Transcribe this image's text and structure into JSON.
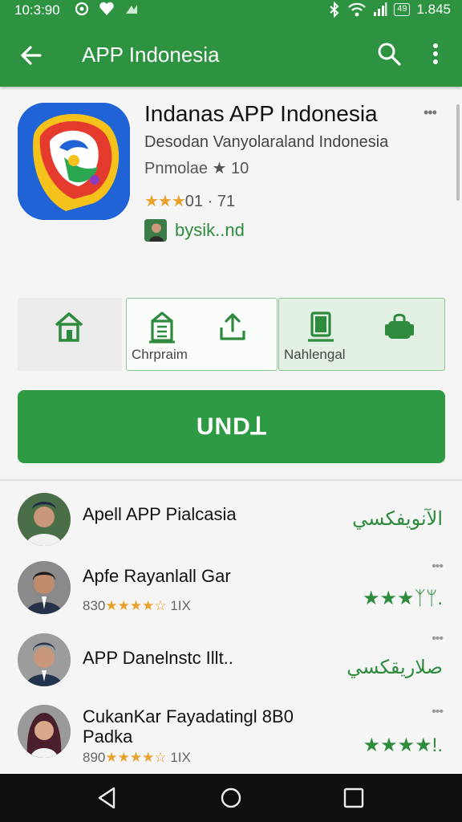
{
  "status_bar": {
    "time": "10:3:90",
    "battery": "49",
    "right_time": "1.845"
  },
  "toolbar": {
    "title": "APP Indonesia"
  },
  "app": {
    "title": "Indanas APP Indonesia",
    "subtitle": "Desodan Vanyolaraland Indonesia",
    "meta": "Pnmolae ★ 10",
    "rating_stars": "★★★",
    "rating_text": "01 · 71",
    "developer": "bysik..nd",
    "colors": {
      "accent": "#2e9340",
      "star": "#e8a12a",
      "icon_bg": "#1f63d6"
    }
  },
  "actions": [
    {
      "label": "",
      "icons": [
        "home-icon"
      ]
    },
    {
      "label": "Chrpraim",
      "icons": [
        "building-icon",
        "share-icon"
      ]
    },
    {
      "label": "Nahlengal",
      "icons": [
        "device-icon",
        "bag-icon"
      ]
    }
  ],
  "main_button": {
    "label": "UNDꓕ"
  },
  "reviews": [
    {
      "name": "Apell APP Pialcasia",
      "sub_prefix": "",
      "sub_stars": "",
      "sub_suffix": "",
      "right": "الآنويفكسي",
      "dots": ""
    },
    {
      "name": "Apfe Rayanlall Gar",
      "sub_prefix": "830",
      "sub_stars": "★★★★☆",
      "sub_suffix": "1IX",
      "right": "★★★ᛉᛘ.",
      "dots": "•••"
    },
    {
      "name": "APP Danelnstc Illt..",
      "sub_prefix": "",
      "sub_stars": "",
      "sub_suffix": "",
      "right": "صلاريقكسي",
      "dots": "•••"
    },
    {
      "name": "CukanKar Fayadatingl 8B0\nPadka",
      "sub_prefix": "890",
      "sub_stars": "★★★★☆",
      "sub_suffix": "1IX",
      "right": "★★★★!.",
      "dots": "•••"
    }
  ]
}
